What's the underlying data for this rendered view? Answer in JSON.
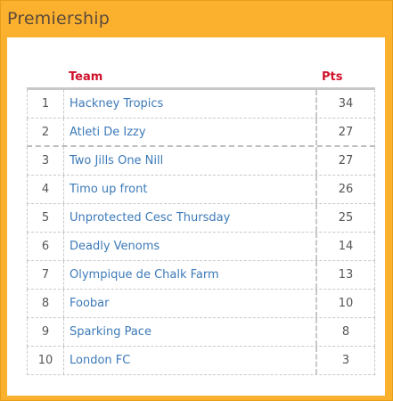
{
  "panel": {
    "title": "Premiership"
  },
  "table": {
    "headers": {
      "team": "Team",
      "pts": "Pts"
    },
    "rows": [
      {
        "pos": "1",
        "team": "Hackney Tropics",
        "pts": "34"
      },
      {
        "pos": "2",
        "team": "Atleti De Izzy",
        "pts": "27"
      },
      {
        "pos": "3",
        "team": "Two Jills One Nill",
        "pts": "27"
      },
      {
        "pos": "4",
        "team": "Timo up front",
        "pts": "26"
      },
      {
        "pos": "5",
        "team": "Unprotected Cesc Thursday",
        "pts": "25"
      },
      {
        "pos": "6",
        "team": "Deadly Venoms",
        "pts": "14"
      },
      {
        "pos": "7",
        "team": "Olympique de Chalk Farm",
        "pts": "13"
      },
      {
        "pos": "8",
        "team": "Foobar",
        "pts": "10"
      },
      {
        "pos": "9",
        "team": "Sparking Pace",
        "pts": "8"
      },
      {
        "pos": "10",
        "team": "London FC",
        "pts": "3"
      }
    ]
  },
  "colors": {
    "frame": "#fbb12e",
    "header_text": "#d0112b",
    "team_link": "#3d7ab8"
  }
}
